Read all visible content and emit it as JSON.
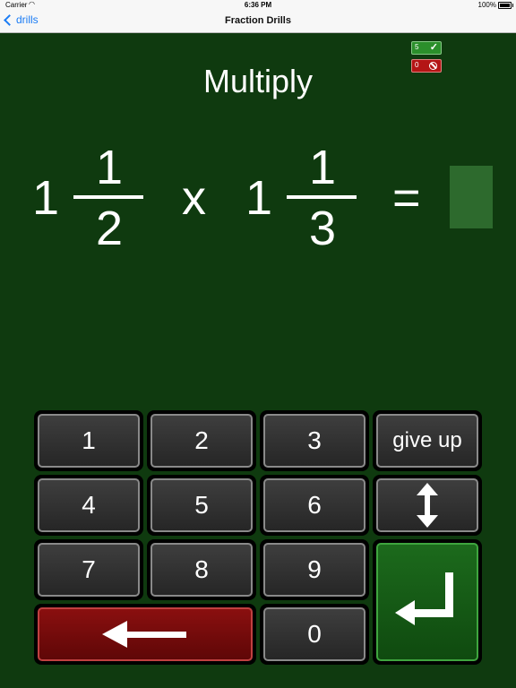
{
  "status_bar": {
    "carrier": "Carrier",
    "time": "6:36 PM",
    "battery": "100%"
  },
  "nav": {
    "back_label": "drills",
    "title": "Fraction Drills"
  },
  "score": {
    "correct": "5",
    "wrong": "0"
  },
  "operation": "Multiply",
  "equation": {
    "left": {
      "whole": "1",
      "numerator": "1",
      "denominator": "2"
    },
    "operator": "x",
    "right": {
      "whole": "1",
      "numerator": "1",
      "denominator": "3"
    },
    "equals": "="
  },
  "keypad": {
    "k1": "1",
    "k2": "2",
    "k3": "3",
    "give_up": "give up",
    "k4": "4",
    "k5": "5",
    "k6": "6",
    "k7": "7",
    "k8": "8",
    "k9": "9",
    "k0": "0"
  },
  "icons": {
    "backspace": "arrow-left-icon",
    "toggle": "up-down-arrow-icon",
    "enter": "return-arrow-icon",
    "correct": "checkmark-icon",
    "wrong": "no-entry-icon"
  },
  "colors": {
    "background": "#0f3a0f",
    "key_red": "#8a0f0f",
    "key_green": "#1c6a1c",
    "link": "#1b7cf5"
  }
}
